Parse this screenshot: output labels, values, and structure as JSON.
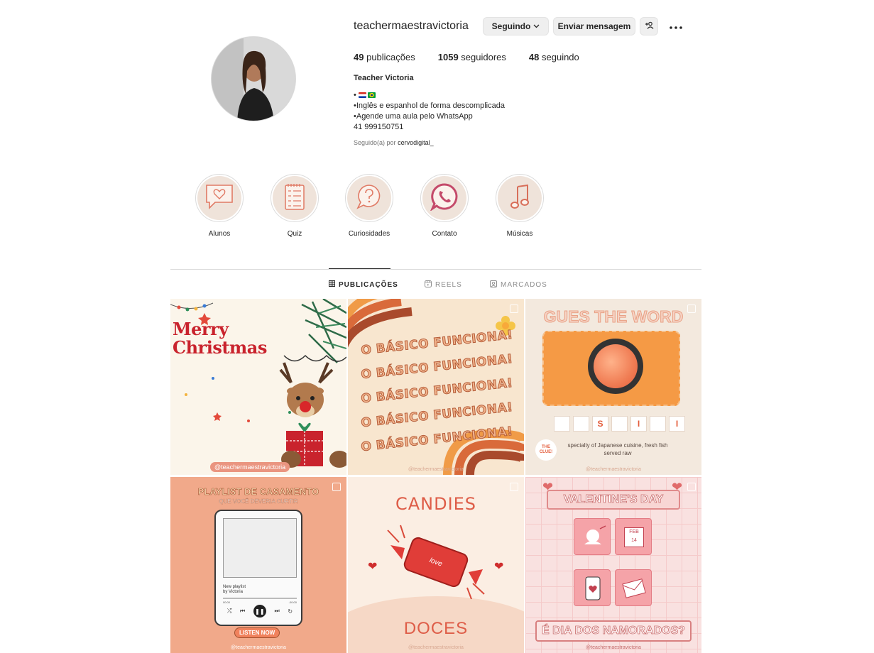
{
  "profile": {
    "username": "teachermaestravictoria",
    "follow_label": "Seguindo",
    "message_label": "Enviar mensagem",
    "stats": {
      "posts_count": "49",
      "posts_label": "publicações",
      "followers_count": "1059",
      "followers_label": "seguidores",
      "following_count": "48",
      "following_label": "seguindo"
    },
    "full_name": "Teacher Victoria",
    "bio_line_1": "•",
    "bio_line_2": "•Inglês e espanhol de forma descomplicada",
    "bio_line_3": "•Agende uma aula pelo WhatsApp",
    "bio_line_4": "41 999150751",
    "followed_by_prefix": "Seguido(a) por",
    "followed_by_user": "cervodigital_"
  },
  "highlights": [
    {
      "label": "Alunos",
      "icon": "speech-heart-icon"
    },
    {
      "label": "Quiz",
      "icon": "checklist-icon"
    },
    {
      "label": "Curiosidades",
      "icon": "question-bubble-icon"
    },
    {
      "label": "Contato",
      "icon": "whatsapp-icon"
    },
    {
      "label": "Músicas",
      "icon": "music-note-icon"
    }
  ],
  "tabs": [
    {
      "label": "PUBLICAÇÕES",
      "icon": "grid-icon",
      "active": true
    },
    {
      "label": "REELS",
      "icon": "reels-icon",
      "active": false
    },
    {
      "label": "MARCADOS",
      "icon": "tagged-icon",
      "active": false
    }
  ],
  "posts": {
    "p1": {
      "line1": "Merry",
      "line2": "Christmas",
      "handle": "@teachermaestravictoria"
    },
    "p2": {
      "phrase": "O BÁSICO FUNCIONA!",
      "handle": "@teachermaestravictoria"
    },
    "p3": {
      "title": "GUES THE WORD",
      "letters": [
        "",
        "",
        "S",
        "",
        "I",
        "",
        "I"
      ],
      "clue_badge": "THE CLUE!",
      "clue": "specialty of Japanese cuisine, fresh fish served raw",
      "handle": "@teachermaestravictoria"
    },
    "p4": {
      "title": "PLAYLIST DE CASAMENTO",
      "subtitle": "QUE VOCÊ DEVERIA CURTIR",
      "playlist_name": "New playlist",
      "playlist_by": "by Victoria",
      "time_start": "00:00",
      "time_end": "-00:00",
      "listen": "LISTEN NOW",
      "handle": "@teachermaestravictoria"
    },
    "p5": {
      "top": "CANDIES",
      "bottom": "DOCES",
      "candy_text": "love",
      "handle": "@teachermaestravictoria"
    },
    "p6": {
      "title": "VALENTINE'S DAY",
      "date_month": "FEB",
      "date_day": "14",
      "bottom": "É DIA DOS NAMORADOS?",
      "handle": "@teachermaestravictoria"
    }
  },
  "colors": {
    "accent_red": "#c9232d",
    "brand_peach": "#f1a98a",
    "button_gray": "#efefef",
    "divider": "#dbdbdb"
  }
}
